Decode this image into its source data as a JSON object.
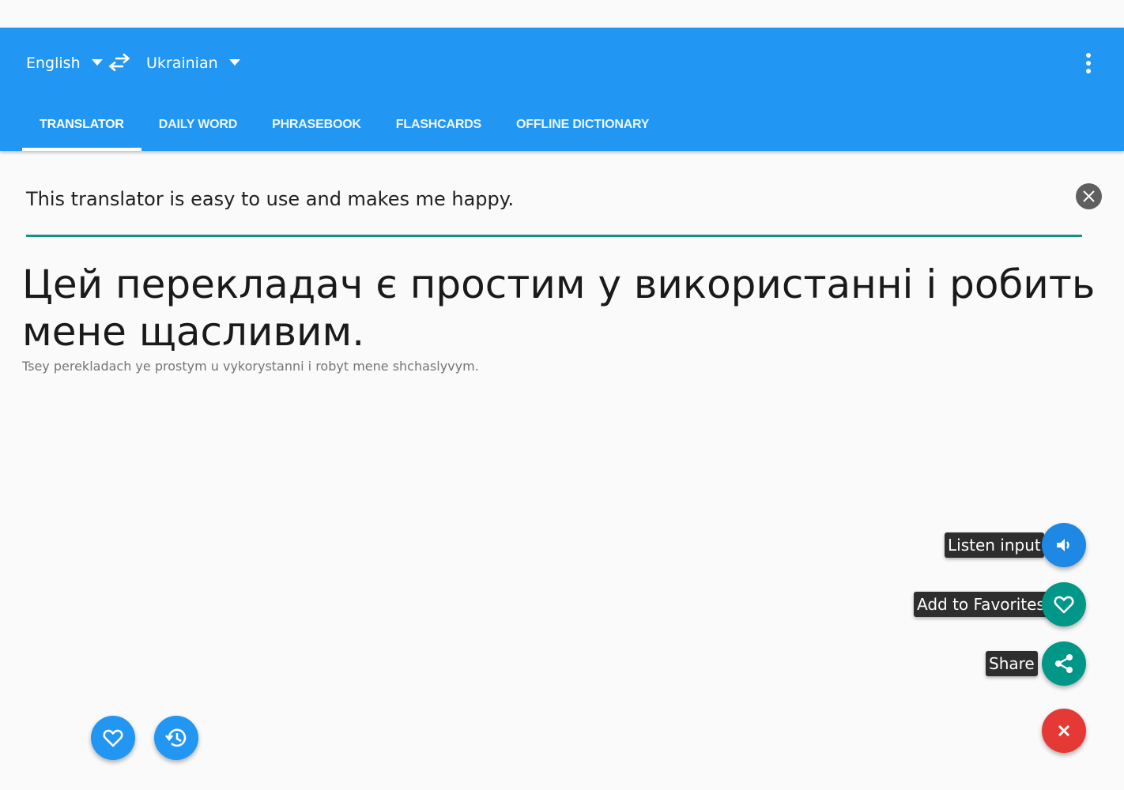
{
  "source_language": "English",
  "target_language": "Ukrainian",
  "tabs": [
    {
      "label": "TRANSLATOR",
      "active": true
    },
    {
      "label": "DAILY WORD",
      "active": false
    },
    {
      "label": "PHRASEBOOK",
      "active": false
    },
    {
      "label": "FLASHCARDS",
      "active": false
    },
    {
      "label": "OFFLINE DICTIONARY",
      "active": false
    }
  ],
  "input": {
    "value": "This translator is easy to use and makes me happy."
  },
  "output": {
    "translation": "Цей перекладач є простим у використанні і робить мене щасливим.",
    "transliteration": "Tsey perekladach ye prostym u vykorystanni i robyt  mene shchaslyvym."
  },
  "fab_actions": [
    {
      "label": "Listen input",
      "icon": "speaker-icon"
    },
    {
      "label": "Add to Favorites",
      "icon": "heart-icon"
    },
    {
      "label": "Share",
      "icon": "share-icon"
    }
  ],
  "colors": {
    "app_bar": "#2196f3",
    "accent_teal": "#009688",
    "close_red": "#e53935"
  }
}
